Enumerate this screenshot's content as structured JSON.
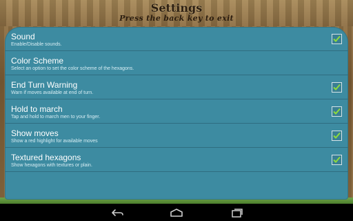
{
  "header": {
    "title": "Settings",
    "subtitle": "Press the back key to exit"
  },
  "settings": [
    {
      "title": "Sound",
      "desc": "Enable/Disable sounds.",
      "has_checkbox": true,
      "checked": true
    },
    {
      "title": "Color Scheme",
      "desc": "Select an option to set the color scheme of the hexagons.",
      "has_checkbox": false,
      "checked": false
    },
    {
      "title": "End Turn Warning",
      "desc": "Warn if moves available at end of turn.",
      "has_checkbox": true,
      "checked": true
    },
    {
      "title": "Hold to march",
      "desc": "Tap and hold to march men to your finger.",
      "has_checkbox": true,
      "checked": true
    },
    {
      "title": "Show moves",
      "desc": "Show a red highlight for available moves",
      "has_checkbox": true,
      "checked": true
    },
    {
      "title": "Textured hexagons",
      "desc": "Show hexagons with textures or plain.",
      "has_checkbox": true,
      "checked": true
    }
  ],
  "navbar": {
    "buttons": [
      "back-icon",
      "home-icon",
      "recent-apps-icon"
    ]
  },
  "colors": {
    "panel": "#3d8ba1",
    "check": "#8fdc3a",
    "frame": "#8c6c40"
  }
}
